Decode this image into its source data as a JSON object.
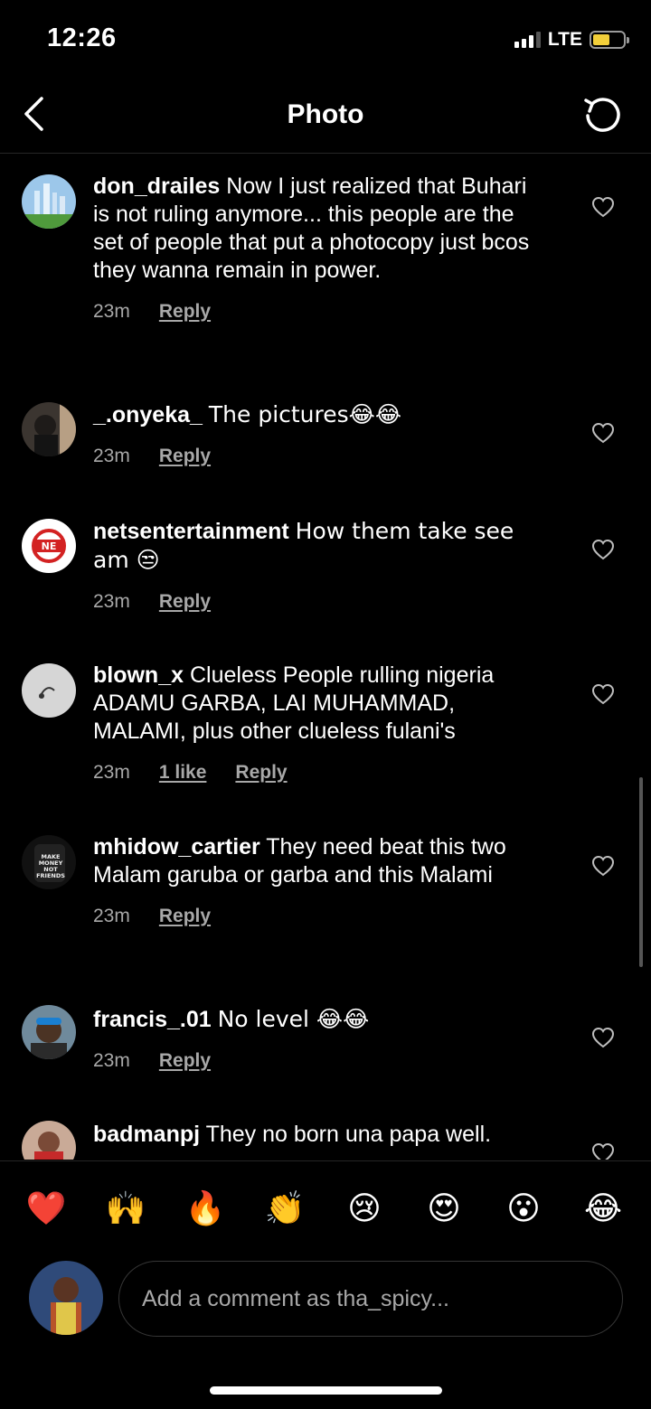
{
  "status_bar": {
    "time": "12:26",
    "network": "LTE"
  },
  "nav": {
    "title": "Photo",
    "back_icon": "chevron-left-icon",
    "refresh_icon": "refresh-icon"
  },
  "comments": [
    {
      "username": "don_drailes",
      "text": "Now I just realized that Buhari is not ruling anymore... this people are the set of people that put a photocopy just bcos they wanna remain in power.",
      "time": "23m",
      "likes": "",
      "reply": "Reply"
    },
    {
      "username": "_.onyeka_",
      "text": "The pictures😂😂",
      "time": "23m",
      "likes": "",
      "reply": "Reply"
    },
    {
      "username": "netsentertainment",
      "text": "How them take see am 😒",
      "time": "23m",
      "likes": "",
      "reply": "Reply"
    },
    {
      "username": "blown_x",
      "text": "Clueless People rulling nigeria ADAMU GARBA, LAI MUHAMMAD, MALAMI, plus other clueless  fulani's",
      "time": "23m",
      "likes": "1 like",
      "reply": "Reply"
    },
    {
      "username": "mhidow_cartier",
      "text": "They need beat  this two Malam garuba or garba and this Malami",
      "time": "23m",
      "likes": "",
      "reply": "Reply"
    },
    {
      "username": "francis_.01",
      "text": "No level 😂😂",
      "time": "23m",
      "likes": "",
      "reply": "Reply"
    },
    {
      "username": "badmanpj",
      "text": "They no born una papa well.",
      "time": "",
      "likes": "",
      "reply": ""
    }
  ],
  "reactions": [
    "❤️",
    "🙌",
    "🔥",
    "👏",
    "😢",
    "😍",
    "😮",
    "😂"
  ],
  "composer": {
    "placeholder": "Add a comment as tha_spicy..."
  },
  "colors": {
    "background": "#000000",
    "secondary_text": "#a8a8a8",
    "divider": "#262626",
    "battery": "#f2cf3a"
  }
}
